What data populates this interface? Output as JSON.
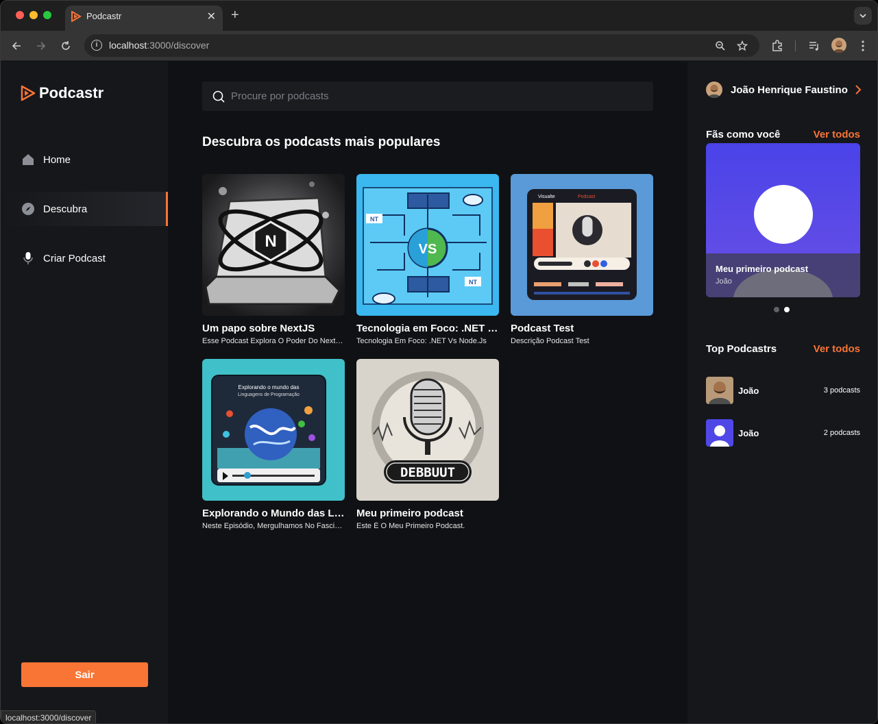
{
  "browser": {
    "tab_title": "Podcastr",
    "url_host": "localhost",
    "url_path": ":3000/discover",
    "status_url": "localhost:3000/discover"
  },
  "sidebar": {
    "logo_text": "Podcastr",
    "items": [
      {
        "label": "Home",
        "icon": "home-icon"
      },
      {
        "label": "Descubra",
        "icon": "compass-icon"
      },
      {
        "label": "Criar Podcast",
        "icon": "microphone-icon"
      }
    ],
    "logout_label": "Sair"
  },
  "main": {
    "search_placeholder": "Procure por podcasts",
    "section_title": "Descubra os podcasts mais populares",
    "podcasts": [
      {
        "title": "Um papo sobre NextJS",
        "description": "Esse Podcast Explora O Poder Do Next.Js"
      },
      {
        "title": "Tecnologia em Foco: .NET vs Node.js",
        "description": "Tecnologia Em Foco: .NET Vs Node.Js"
      },
      {
        "title": "Podcast Test",
        "description": "Descrição Podcast Test"
      },
      {
        "title": "Explorando o Mundo das Linguagens de Programação",
        "description": "Neste Episódio, Mergulhamos No Fascinante Mundo"
      },
      {
        "title": "Meu primeiro podcast",
        "description": "Este É O Meu Primeiro Podcast."
      }
    ],
    "debbuut_label": "DEBBUUT"
  },
  "right": {
    "profile_name": "João Henrique Faustino",
    "fans_title": "Fãs como você",
    "fans_link": "Ver todos",
    "fans_card": {
      "title": "Meu primeiro podcast",
      "author": "João"
    },
    "carousel": {
      "count": 2,
      "active": 2
    },
    "top_title": "Top Podcastrs",
    "top_link": "Ver todos",
    "top_podcastrs": [
      {
        "name": "João",
        "count": "3 podcasts"
      },
      {
        "name": "João",
        "count": "2 podcasts"
      }
    ]
  },
  "colors": {
    "accent": "#f97535",
    "bg": "#101114",
    "panel": "#16171b"
  }
}
